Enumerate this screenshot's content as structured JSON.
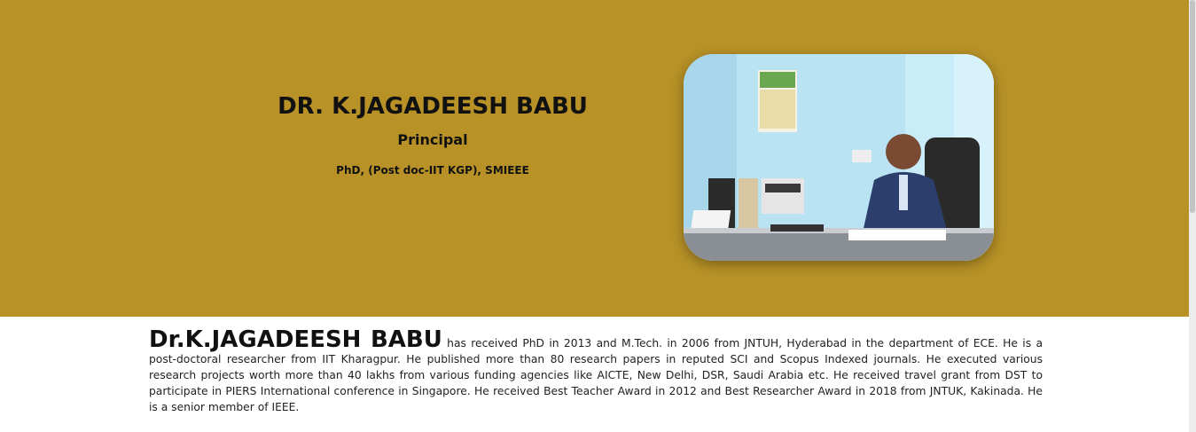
{
  "hero": {
    "name": "DR. K.JAGADEESH BABU",
    "role": "Principal",
    "qualifications": "PhD, (Post doc-IIT KGP), SMIEEE",
    "background_color": "#b89227",
    "photo_icon": "principal-photo"
  },
  "bio": {
    "name": "Dr.K.JAGADEESH BABU",
    "text": " has received PhD in 2013 and M.Tech. in 2006 from JNTUH, Hyderabad in the department of ECE. He is a post-doctoral researcher from IIT Kharagpur. He published more than 80 research papers in reputed SCI and Scopus Indexed journals. He executed various research projects worth more than 40 lakhs from various funding agencies like AICTE, New Delhi, DSR, Saudi Arabia etc. He received travel grant from DST to participate in PIERS International conference in Singapore. He received Best Teacher Award in 2012 and Best Researcher Award in 2018 from JNTUK, Kakinada. He is a senior member of IEEE."
  }
}
